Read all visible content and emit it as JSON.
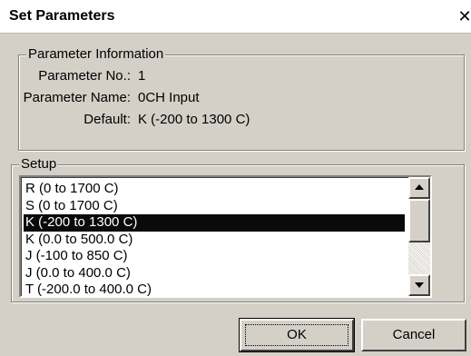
{
  "dialog": {
    "title": "Set Parameters",
    "close_glyph": "✕"
  },
  "info": {
    "legend": "Parameter Information",
    "param_no_label": "Parameter No.:",
    "param_no_value": "1",
    "param_name_label": "Parameter Name:",
    "param_name_value": "0CH Input",
    "default_label": "Default:",
    "default_value": "K (-200 to 1300 C)"
  },
  "setup": {
    "legend": "Setup",
    "items": [
      "R (0 to 1700 C)",
      "S (0 to 1700 C)",
      "K (-200 to 1300 C)",
      "K (0.0 to 500.0 C)",
      "J (-100 to 850 C)",
      "J (0.0 to 400.0 C)",
      "T (-200.0 to 400.0 C)"
    ],
    "selected_index": 2
  },
  "buttons": {
    "ok": "OK",
    "cancel": "Cancel"
  },
  "icons": {
    "close": "close-icon",
    "scroll_up": "arrow-up-icon",
    "scroll_down": "arrow-down-icon"
  }
}
